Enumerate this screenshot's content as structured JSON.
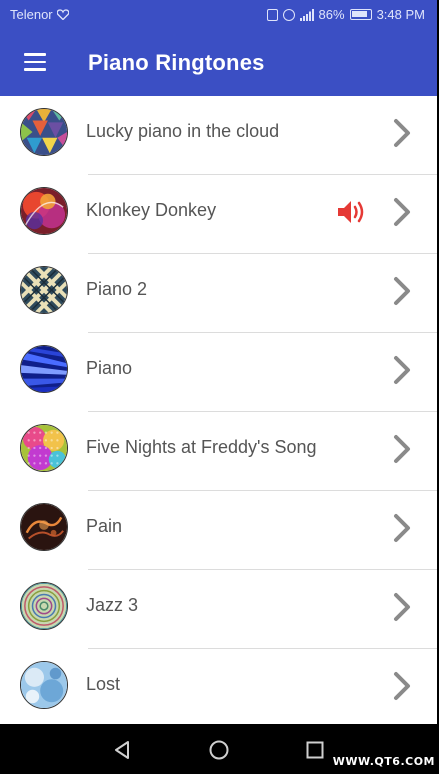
{
  "status_bar": {
    "carrier": "Telenor",
    "battery": "86%",
    "time": "3:48 PM"
  },
  "app_bar": {
    "title": "Piano Ringtones"
  },
  "ringtones": [
    {
      "label": "Lucky piano in the cloud",
      "playing": false
    },
    {
      "label": "Klonkey Donkey",
      "playing": true
    },
    {
      "label": "Piano 2",
      "playing": false
    },
    {
      "label": "Piano",
      "playing": false
    },
    {
      "label": "Five Nights at Freddy's Song",
      "playing": false
    },
    {
      "label": "Pain",
      "playing": false
    },
    {
      "label": "Jazz 3",
      "playing": false
    },
    {
      "label": "Lost",
      "playing": false
    }
  ],
  "watermark": "WWW.QT6.COM",
  "colors": {
    "primary": "#3b4fc4",
    "speaker": "#e53935",
    "chevron": "#8a8a8a",
    "text": "#555555"
  }
}
